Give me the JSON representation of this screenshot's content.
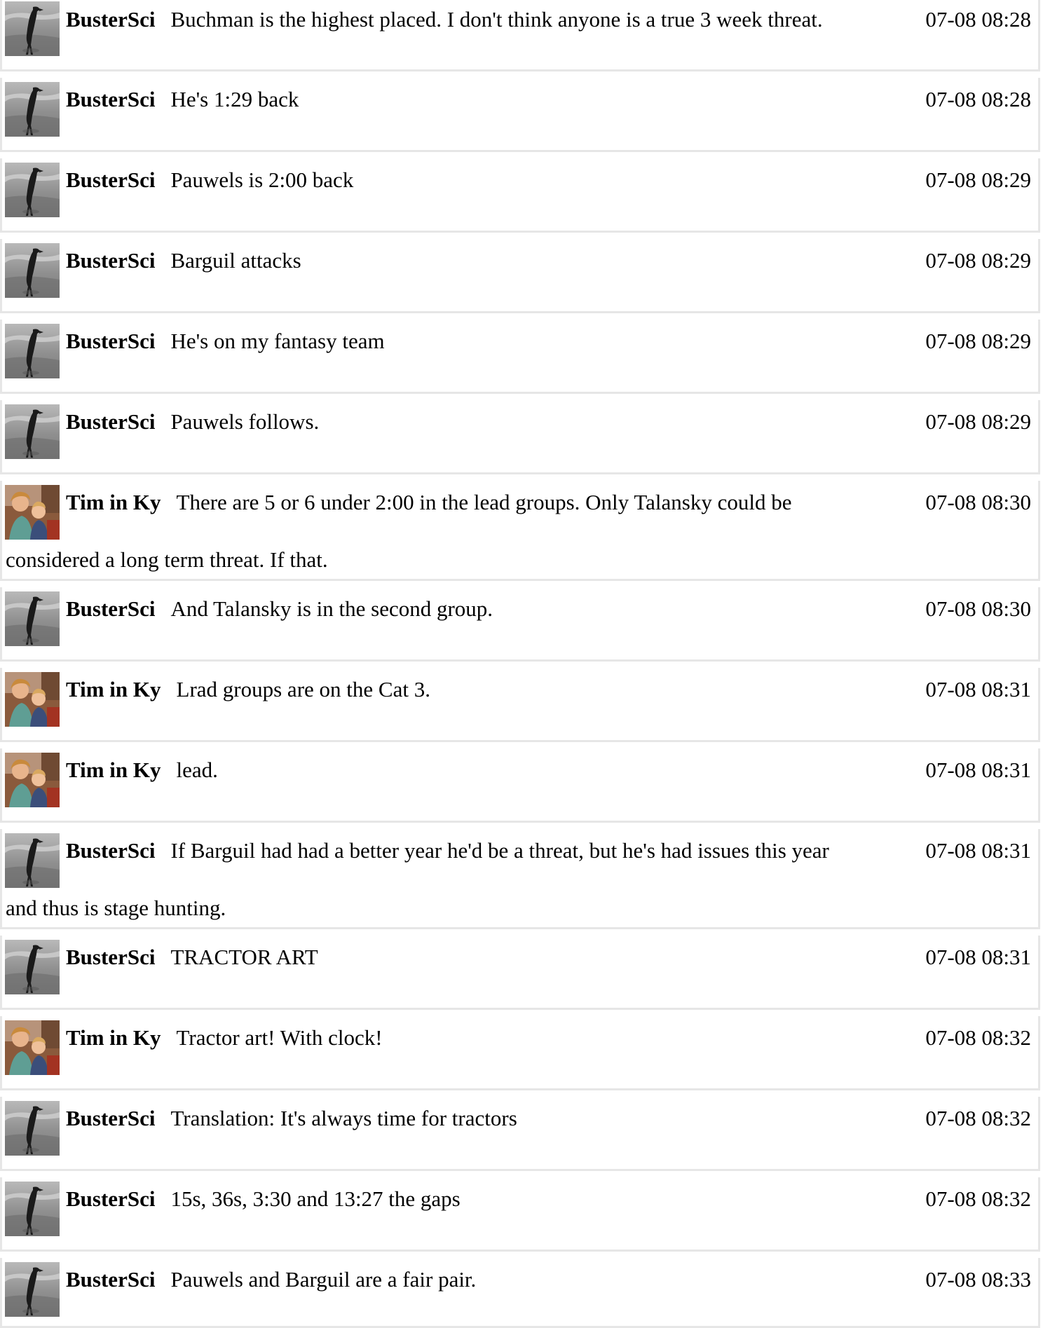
{
  "messages": [
    {
      "author": "BusterSci",
      "avatar": "crow-avatar",
      "text": "Buchman is the highest placed. I don't think anyone is a true 3 week threat.",
      "text2": "",
      "time": "07-08 08:28"
    },
    {
      "author": "BusterSci",
      "avatar": "crow-avatar",
      "text": "He's 1:29 back",
      "text2": "",
      "time": "07-08 08:28"
    },
    {
      "author": "BusterSci",
      "avatar": "crow-avatar",
      "text": "Pauwels is 2:00 back",
      "text2": "",
      "time": "07-08 08:29"
    },
    {
      "author": "BusterSci",
      "avatar": "crow-avatar",
      "text": "Barguil attacks",
      "text2": "",
      "time": "07-08 08:29"
    },
    {
      "author": "BusterSci",
      "avatar": "crow-avatar",
      "text": "He's on my fantasy team",
      "text2": "",
      "time": "07-08 08:29"
    },
    {
      "author": "BusterSci",
      "avatar": "crow-avatar",
      "text": "Pauwels follows.",
      "text2": "",
      "time": "07-08 08:29"
    },
    {
      "author": "Tim in Ky",
      "avatar": "kids-photo-avatar",
      "text": "There are 5 or 6 under 2:00 in the lead groups. Only Talansky could be",
      "text2": "considered a long term threat. If that.",
      "time": "07-08 08:30"
    },
    {
      "author": "BusterSci",
      "avatar": "crow-avatar",
      "text": "And Talansky is in the second group.",
      "text2": "",
      "time": "07-08 08:30"
    },
    {
      "author": "Tim in Ky",
      "avatar": "kids-photo-avatar",
      "text": "Lrad groups are on the Cat 3.",
      "text2": "",
      "time": "07-08 08:31"
    },
    {
      "author": "Tim in Ky",
      "avatar": "kids-photo-avatar",
      "text": "lead.",
      "text2": "",
      "time": "07-08 08:31"
    },
    {
      "author": "BusterSci",
      "avatar": "crow-avatar",
      "text": "If Barguil had had a better year he'd be a threat, but he's had issues this year",
      "text2": "and thus is stage hunting.",
      "time": "07-08 08:31"
    },
    {
      "author": "BusterSci",
      "avatar": "crow-avatar",
      "text": "TRACTOR ART",
      "text2": "",
      "time": "07-08 08:31"
    },
    {
      "author": "Tim in Ky",
      "avatar": "kids-photo-avatar",
      "text": "Tractor art! With clock!",
      "text2": "",
      "time": "07-08 08:32"
    },
    {
      "author": "BusterSci",
      "avatar": "crow-avatar",
      "text": "Translation: It's always time for tractors",
      "text2": "",
      "time": "07-08 08:32"
    },
    {
      "author": "BusterSci",
      "avatar": "crow-avatar",
      "text": "15s, 36s, 3:30 and 13:27 the gaps",
      "text2": "",
      "time": "07-08 08:32"
    },
    {
      "author": "BusterSci",
      "avatar": "crow-avatar",
      "text": "Pauwels and Barguil are a fair pair.",
      "text2": "",
      "time": "07-08 08:33"
    }
  ]
}
